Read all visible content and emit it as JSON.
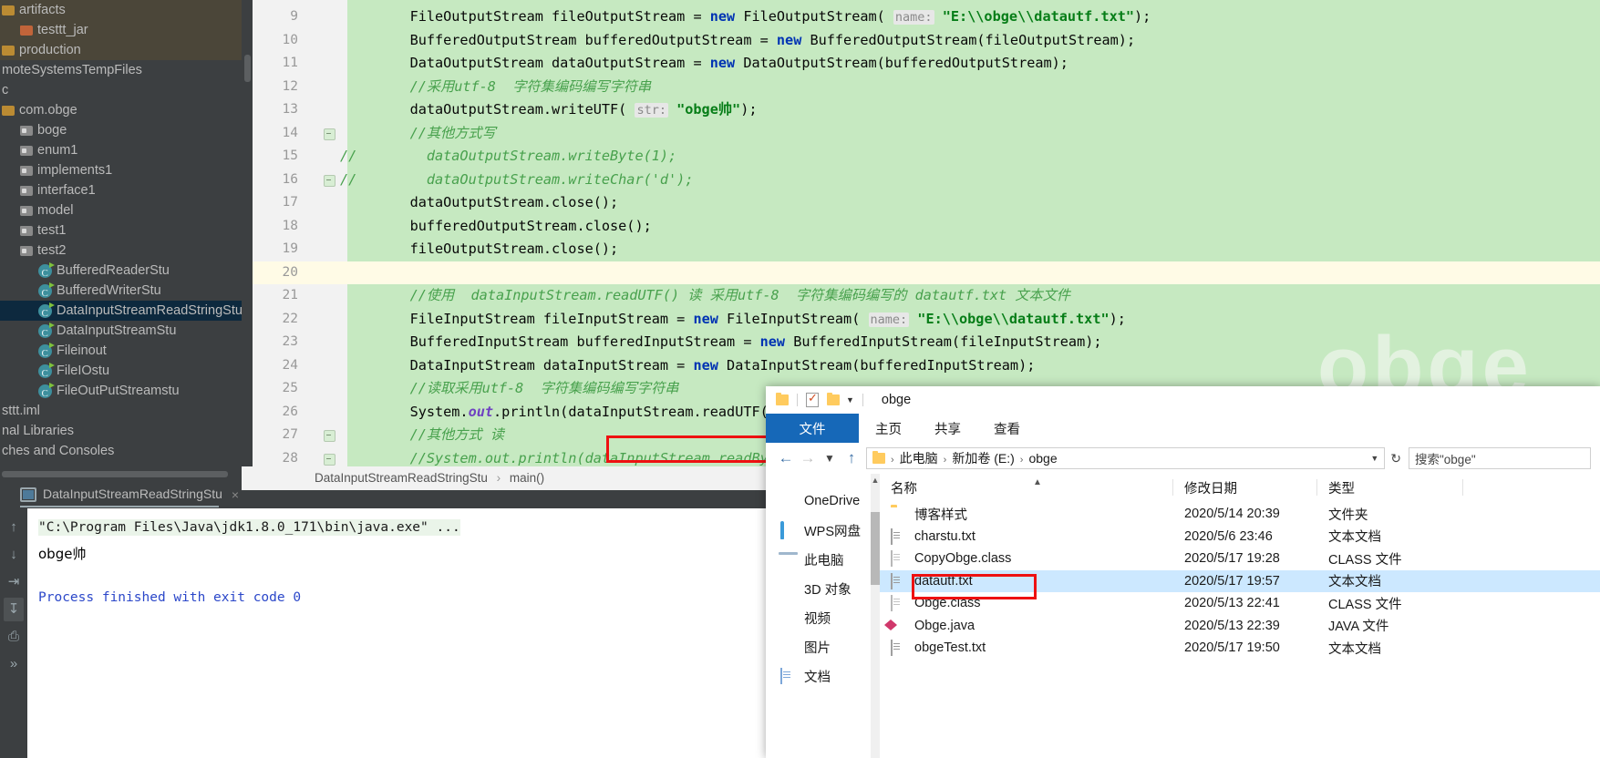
{
  "ide": {
    "project_tree": [
      {
        "label": "artifacts",
        "icon": "module-folder-icon",
        "indent": 0,
        "style": "brownbg"
      },
      {
        "label": "testtt_jar",
        "icon": "folder-orange-icon",
        "indent": 1,
        "style": "brownbg"
      },
      {
        "label": "production",
        "icon": "module-folder-icon",
        "indent": 0,
        "style": "brownbg"
      },
      {
        "label": "moteSystemsTempFiles",
        "icon": "none",
        "indent": 0,
        "style": ""
      },
      {
        "label": "c",
        "icon": "none",
        "indent": 0,
        "style": ""
      },
      {
        "label": "com.obge",
        "icon": "module-folder-icon",
        "indent": 0,
        "style": ""
      },
      {
        "label": "boge",
        "icon": "folder-icon",
        "indent": 1,
        "style": ""
      },
      {
        "label": "enum1",
        "icon": "folder-icon",
        "indent": 1,
        "style": ""
      },
      {
        "label": "implements1",
        "icon": "folder-icon",
        "indent": 1,
        "style": ""
      },
      {
        "label": "interface1",
        "icon": "folder-icon",
        "indent": 1,
        "style": ""
      },
      {
        "label": "model",
        "icon": "folder-icon",
        "indent": 1,
        "style": ""
      },
      {
        "label": "test1",
        "icon": "folder-icon",
        "indent": 1,
        "style": ""
      },
      {
        "label": "test2",
        "icon": "folder-icon",
        "indent": 1,
        "style": ""
      },
      {
        "label": "BufferedReaderStu",
        "icon": "java-class-icon",
        "indent": 2,
        "style": ""
      },
      {
        "label": "BufferedWriterStu",
        "icon": "java-class-icon",
        "indent": 2,
        "style": ""
      },
      {
        "label": "DataInputStreamReadStringStu",
        "icon": "java-class-icon",
        "indent": 2,
        "style": "selected"
      },
      {
        "label": "DataInputStreamStu",
        "icon": "java-class-icon",
        "indent": 2,
        "style": ""
      },
      {
        "label": "Fileinout",
        "icon": "java-class-icon",
        "indent": 2,
        "style": ""
      },
      {
        "label": "FileIOstu",
        "icon": "java-class-icon",
        "indent": 2,
        "style": ""
      },
      {
        "label": "FileOutPutStreamstu",
        "icon": "java-class-icon",
        "indent": 2,
        "style": ""
      },
      {
        "label": "sttt.iml",
        "icon": "none",
        "indent": 0,
        "style": ""
      },
      {
        "label": "nal Libraries",
        "icon": "none",
        "indent": 0,
        "style": ""
      },
      {
        "label": "ches and Consoles",
        "icon": "none",
        "indent": 0,
        "style": ""
      }
    ],
    "breadcrumb": {
      "class": "DataInputStreamReadStringStu",
      "separator": "›",
      "method": "main()"
    },
    "editor": {
      "watermark": "obge",
      "lines": [
        {
          "num": "9",
          "bg": "green",
          "html": "<span class=\"plain\">    FileOutputStream fileOutputStream = </span><span class=\"k\">new</span><span class=\"plain\"> FileOutputStream( </span><span class=\"param\">name:</span><span class=\"plain\"> </span><span class=\"s\">\"E:\\\\obge\\\\datautf.txt\"</span><span class=\"plain\">);</span>"
        },
        {
          "num": "10",
          "bg": "green",
          "html": "<span class=\"plain\">    BufferedOutputStream bufferedOutputStream = </span><span class=\"k\">new</span><span class=\"plain\"> BufferedOutputStream(fileOutputStream);</span>"
        },
        {
          "num": "11",
          "bg": "green",
          "html": "<span class=\"plain\">    DataOutputStream dataOutputStream = </span><span class=\"k\">new</span><span class=\"plain\"> DataOutputStream(bufferedOutputStream);</span>"
        },
        {
          "num": "12",
          "bg": "green",
          "html": "<span class=\"cm\">    //采用utf-8  字符集编码编写字符串</span>"
        },
        {
          "num": "13",
          "bg": "green",
          "html": "<span class=\"plain\">    dataOutputStream.writeUTF( </span><span class=\"param\">str:</span><span class=\"plain\"> </span><span class=\"s\">\"obge帅\"</span><span class=\"plain\">);</span>"
        },
        {
          "num": "14",
          "bg": "green",
          "fold": true,
          "html": "<span class=\"cm\">    //其他方式写</span>"
        },
        {
          "num": "15",
          "bg": "green",
          "gutcomment": "//",
          "html": "<span class=\"cm\">      dataOutputStream.writeByte(1);</span>"
        },
        {
          "num": "16",
          "bg": "green",
          "gutcomment": "//",
          "foldend": true,
          "html": "<span class=\"cm\">      dataOutputStream.writeChar('d');</span>"
        },
        {
          "num": "17",
          "bg": "green",
          "html": "<span class=\"plain\">    dataOutputStream.close();</span>"
        },
        {
          "num": "18",
          "bg": "green",
          "html": "<span class=\"plain\">    bufferedOutputStream.close();</span>"
        },
        {
          "num": "19",
          "bg": "green",
          "html": "<span class=\"plain\">    fileOutputStream.close();</span>"
        },
        {
          "num": "20",
          "bg": "cream",
          "html": ""
        },
        {
          "num": "21",
          "bg": "green",
          "html": "<span class=\"cm\">    //使用  dataInputStream.readUTF() 读 采用utf-8  字符集编码编写的 datautf.txt 文本文件</span>"
        },
        {
          "num": "22",
          "bg": "green",
          "html": "<span class=\"plain\">    FileInputStream fileInputStream = </span><span class=\"k\">new</span><span class=\"plain\"> FileInputStream( </span><span class=\"param\">name:</span><span class=\"plain\"> </span><span class=\"s\">\"E:\\\\obge\\\\datautf.txt\"</span><span class=\"plain\">);</span>"
        },
        {
          "num": "23",
          "bg": "green",
          "html": "<span class=\"plain\">    BufferedInputStream bufferedInputStream = </span><span class=\"k\">new</span><span class=\"plain\"> BufferedInputStream(fileInputStream);</span>"
        },
        {
          "num": "24",
          "bg": "green",
          "html": "<span class=\"plain\">    DataInputStream dataInputStream = </span><span class=\"k\">new</span><span class=\"plain\"> DataInputStream(bufferedInputStream);</span>"
        },
        {
          "num": "25",
          "bg": "green",
          "html": "<span class=\"cm\">    //读取采用utf-8  字符集编码编写字符串</span>"
        },
        {
          "num": "26",
          "bg": "green",
          "html": "<span class=\"plain\">    System.</span><span class=\"stat\">out</span><span class=\"plain\">.println(dataInputStream.readUTF());</span>"
        },
        {
          "num": "27",
          "bg": "green",
          "fold": true,
          "html": "<span class=\"cm\">    //其他方式 读</span>"
        },
        {
          "num": "28",
          "bg": "green",
          "foldend": true,
          "html": "<span class=\"cm\">    //System.out.println(dataInputStream.readByte());</span>"
        }
      ]
    },
    "console": {
      "tab_label": "DataInputStreamReadStringStu",
      "close_label": "×",
      "command": "\"C:\\Program Files\\Java\\jdk1.8.0_171\\bin\\java.exe\" ...",
      "output": "obge帅",
      "exit_line": "Process finished with exit code 0",
      "gutter_buttons": [
        "up-arrow-icon",
        "down-arrow-icon",
        "soft-wrap-icon",
        "scroll-end-icon",
        "print-icon",
        "more-icon"
      ]
    }
  },
  "explorer": {
    "title": "obge",
    "quick_access": [
      "folder-icon",
      "properties-icon",
      "new-folder-icon",
      "customize-caret-icon"
    ],
    "ribbon_tabs": [
      {
        "label": "文件",
        "active": true
      },
      {
        "label": "主页",
        "active": false
      },
      {
        "label": "共享",
        "active": false
      },
      {
        "label": "查看",
        "active": false
      }
    ],
    "address": {
      "crumbs": [
        "此电脑",
        "新加卷 (E:)",
        "obge"
      ],
      "separator": "›"
    },
    "search_placeholder": "搜索\"obge\"",
    "nav_items": [
      {
        "label": "OneDrive",
        "icon": "onedrive-icon"
      },
      {
        "label": "WPS网盘",
        "icon": "wps-cloud-icon"
      },
      {
        "label": "此电脑",
        "icon": "this-pc-icon"
      },
      {
        "label": "3D 对象",
        "icon": "3d-objects-icon"
      },
      {
        "label": "视频",
        "icon": "videos-icon"
      },
      {
        "label": "图片",
        "icon": "pictures-icon"
      },
      {
        "label": "文档",
        "icon": "documents-icon"
      }
    ],
    "columns": [
      "名称",
      "修改日期",
      "类型"
    ],
    "files": [
      {
        "name": "博客样式",
        "date": "2020/5/14 20:39",
        "type": "文件夹",
        "icon": "folder-icon",
        "selected": false
      },
      {
        "name": "charstu.txt",
        "date": "2020/5/6 23:46",
        "type": "文本文档",
        "icon": "txt-file-icon",
        "selected": false
      },
      {
        "name": "CopyObge.class",
        "date": "2020/5/17 19:28",
        "type": "CLASS 文件",
        "icon": "class-file-icon",
        "selected": false
      },
      {
        "name": "datautf.txt",
        "date": "2020/5/17 19:57",
        "type": "文本文档",
        "icon": "txt-file-icon",
        "selected": true
      },
      {
        "name": "Obge.class",
        "date": "2020/5/13 22:41",
        "type": "CLASS 文件",
        "icon": "class-file-icon",
        "selected": false
      },
      {
        "name": "Obge.java",
        "date": "2020/5/13 22:39",
        "type": "JAVA 文件",
        "icon": "java-file-icon",
        "selected": false
      },
      {
        "name": "obgeTest.txt",
        "date": "2020/5/17 19:50",
        "type": "文本文档",
        "icon": "txt-file-icon",
        "selected": false
      }
    ]
  },
  "annotations": {
    "color": "#ee1111",
    "code_box": "line-26-highlight",
    "file_box": "datautf-txt-highlight"
  }
}
